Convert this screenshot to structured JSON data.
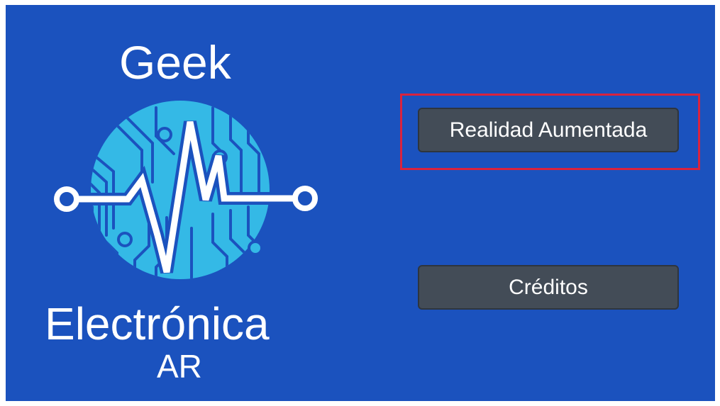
{
  "logo": {
    "title": "Geek",
    "subtitle": "Electrónica",
    "suffix": "AR",
    "emblem_icon": "circuit-heartbeat-icon",
    "colors": {
      "circle": "#34b9e6",
      "traces": "#1b52be",
      "pulse": "#ffffff"
    }
  },
  "menu": {
    "ar_label": "Realidad Aumentada",
    "credits_label": "Créditos"
  },
  "colors": {
    "background": "#1b52be",
    "button": "#434c57",
    "highlight": "#d9233e"
  }
}
